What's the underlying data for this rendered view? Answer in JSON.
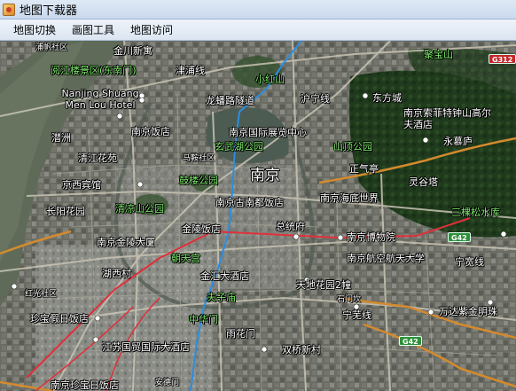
{
  "window": {
    "title": "地图下载器"
  },
  "menu": [
    "地图切换",
    "画图工具",
    "地图访问"
  ],
  "map": {
    "center_label": "南京",
    "labels": [
      {
        "text": "浦帆社区",
        "style": "small"
      },
      {
        "text": "金川新寓",
        "style": ""
      },
      {
        "text": "阅江楼景区(东南门)",
        "style": "green"
      },
      {
        "text": "津浦线",
        "style": ""
      },
      {
        "text": "小红山",
        "style": "green"
      },
      {
        "text": "龙蟠路隧道",
        "style": ""
      },
      {
        "text": "沪宁线",
        "style": ""
      },
      {
        "text": "东方城",
        "style": ""
      },
      {
        "text": "聚宝山",
        "style": "green"
      },
      {
        "text": "Nanjing Shuang Men Lou Hotel",
        "style": "wrap"
      },
      {
        "text": "南京索菲特钟山高尔夫酒店",
        "style": ""
      },
      {
        "text": "南京饭店",
        "style": ""
      },
      {
        "text": "南京国际展览中心",
        "style": ""
      },
      {
        "text": "潜洲",
        "style": ""
      },
      {
        "text": "玄武湖公园",
        "style": "green"
      },
      {
        "text": "山顶公园",
        "style": "green"
      },
      {
        "text": "永慕庐",
        "style": ""
      },
      {
        "text": "清江花苑",
        "style": ""
      },
      {
        "text": "马鞍社区",
        "style": "small"
      },
      {
        "text": "正气亭",
        "style": ""
      },
      {
        "text": "南京",
        "style": "big"
      },
      {
        "text": "京西宾馆",
        "style": ""
      },
      {
        "text": "鼓楼公园",
        "style": "green"
      },
      {
        "text": "灵谷塔",
        "style": ""
      },
      {
        "text": "长阳花园",
        "style": ""
      },
      {
        "text": "清凉山公园",
        "style": "green"
      },
      {
        "text": "南京古南都饭店",
        "style": ""
      },
      {
        "text": "南京海底世界",
        "style": ""
      },
      {
        "text": "三棵松水库",
        "style": "green"
      },
      {
        "text": "金陵饭店",
        "style": ""
      },
      {
        "text": "总统府",
        "style": ""
      },
      {
        "text": "南京金陵大厦",
        "style": ""
      },
      {
        "text": "南京博物院",
        "style": ""
      },
      {
        "text": "南京航空航天大学",
        "style": ""
      },
      {
        "text": "朝天宫",
        "style": "green"
      },
      {
        "text": "湖西村",
        "style": ""
      },
      {
        "text": "宁宽线",
        "style": ""
      },
      {
        "text": "金汇大酒店",
        "style": ""
      },
      {
        "text": "天地花园2幢",
        "style": ""
      },
      {
        "text": "红光社区",
        "style": "small"
      },
      {
        "text": "夫子庙",
        "style": "green"
      },
      {
        "text": "石门坎",
        "style": "small"
      },
      {
        "text": "宁芜线",
        "style": ""
      },
      {
        "text": "珍宝假日饭店",
        "style": ""
      },
      {
        "text": "中华门",
        "style": "green"
      },
      {
        "text": "万达紫金明珠",
        "style": ""
      },
      {
        "text": "江苏国贸国际大酒店",
        "style": ""
      },
      {
        "text": "雨花门",
        "style": ""
      },
      {
        "text": "双桥新村",
        "style": ""
      },
      {
        "text": "南京珍宝日饭店",
        "style": ""
      },
      {
        "text": "安德门",
        "style": "small"
      }
    ],
    "badges": [
      {
        "text": "G312",
        "style": "red"
      },
      {
        "text": "G42",
        "style": ""
      },
      {
        "text": "G42",
        "style": ""
      }
    ]
  }
}
